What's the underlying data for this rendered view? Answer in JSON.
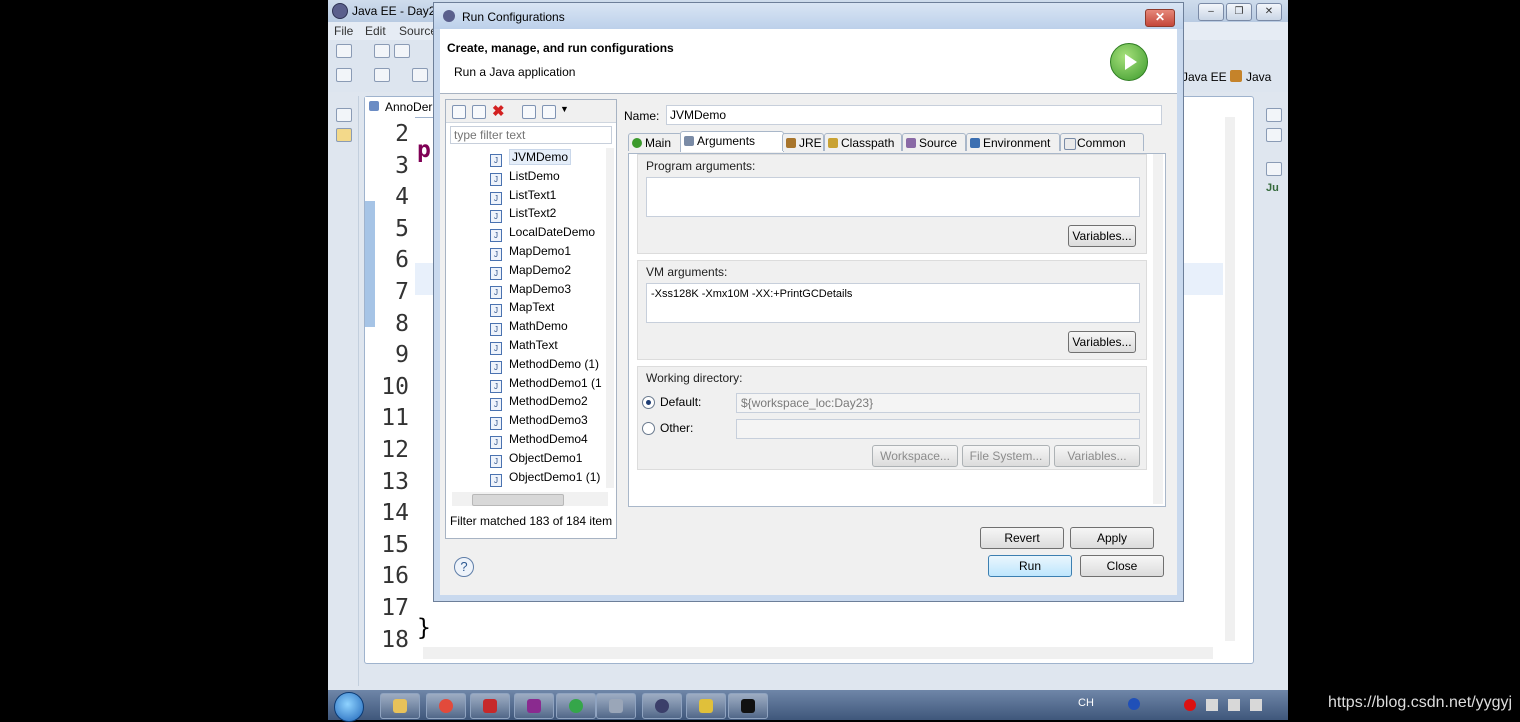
{
  "eclipse": {
    "title": "Java EE - Day2",
    "menu": [
      "File",
      "Edit",
      "Source"
    ],
    "perspectives": [
      "Java EE",
      "Java"
    ],
    "editor_tab": "AnnoDer",
    "line_numbers": [
      "2",
      "3",
      "4",
      "5",
      "6",
      "7",
      "8",
      "9",
      "10",
      "11",
      "12",
      "13",
      "14",
      "15",
      "16",
      "17",
      "18"
    ],
    "code_p": "p",
    "closing_brace": "}",
    "right_trim_label": "Ju"
  },
  "dialog": {
    "title": "Run Configurations",
    "close_glyph": "✕",
    "banner_title": "Create, manage, and run configurations",
    "banner_subtitle": "Run a Java application",
    "filter_placeholder": "type filter text",
    "tree_items": [
      "JVMDemo",
      "ListDemo",
      "ListText1",
      "ListText2",
      "LocalDateDemo",
      "MapDemo1",
      "MapDemo2",
      "MapDemo3",
      "MapText",
      "MathDemo",
      "MathText",
      "MethodDemo (1)",
      "MethodDemo1 (1",
      "MethodDemo2",
      "MethodDemo3",
      "MethodDemo4",
      "ObjectDemo1",
      "ObjectDemo1 (1)"
    ],
    "selected_item": "JVMDemo",
    "filter_status": "Filter matched 183 of 184 item",
    "name_label": "Name:",
    "name_value": "JVMDemo",
    "tabs": [
      "Main",
      "Arguments",
      "JRE",
      "Classpath",
      "Source",
      "Environment",
      "Common"
    ],
    "active_tab": "Arguments",
    "program_args_label": "Program arguments:",
    "program_args_value": "",
    "vm_args_label": "VM arguments:",
    "vm_args_value": "-Xss128K -Xmx10M -XX:+PrintGCDetails",
    "variables_label": "Variables...",
    "working_dir_label": "Working directory:",
    "default_label": "Default:",
    "default_value": "${workspace_loc:Day23}",
    "other_label": "Other:",
    "other_value": "",
    "workspace_btn": "Workspace...",
    "filesystem_btn": "File System...",
    "variables_btn_disabled": "Variables...",
    "revert_label": "Revert",
    "apply_label": "Apply",
    "run_label": "Run",
    "close_label": "Close",
    "help_glyph": "?"
  },
  "taskbar": {
    "tray_text": "CH"
  },
  "watermark": "https://blog.csdn.net/yygyj",
  "colors": {
    "accent": "#3c7fb1",
    "title_bar": "#bcd0ea",
    "run_green": "#3c9a2c"
  }
}
